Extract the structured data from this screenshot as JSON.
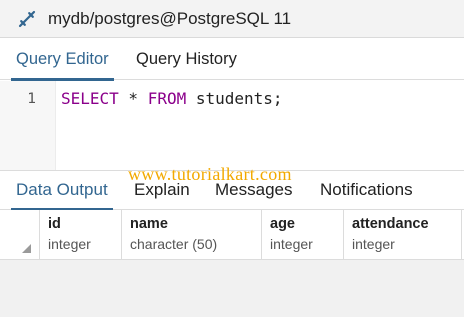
{
  "connection": {
    "icon": "connection-icon",
    "title": "mydb/postgres@PostgreSQL 11"
  },
  "top_tabs": [
    {
      "label": "Query Editor",
      "active": true
    },
    {
      "label": "Query History",
      "active": false
    }
  ],
  "editor": {
    "line_number": "1",
    "tokens": {
      "select": "SELECT",
      "star": " * ",
      "from": "FROM",
      "rest": " students;"
    }
  },
  "watermark": "www.tutorialkart.com",
  "bottom_tabs": [
    {
      "label": "Data Output",
      "active": true
    },
    {
      "label": "Explain",
      "active": false
    },
    {
      "label": "Messages",
      "active": false
    },
    {
      "label": "Notifications",
      "active": false
    }
  ],
  "columns": [
    {
      "name": "id",
      "type": "integer"
    },
    {
      "name": "name",
      "type": "character (50)"
    },
    {
      "name": "age",
      "type": "integer"
    },
    {
      "name": "attendance",
      "type": "integer"
    }
  ],
  "colors": {
    "accent": "#326690",
    "keyword": "#8b008b",
    "watermark": "#f2a900"
  }
}
